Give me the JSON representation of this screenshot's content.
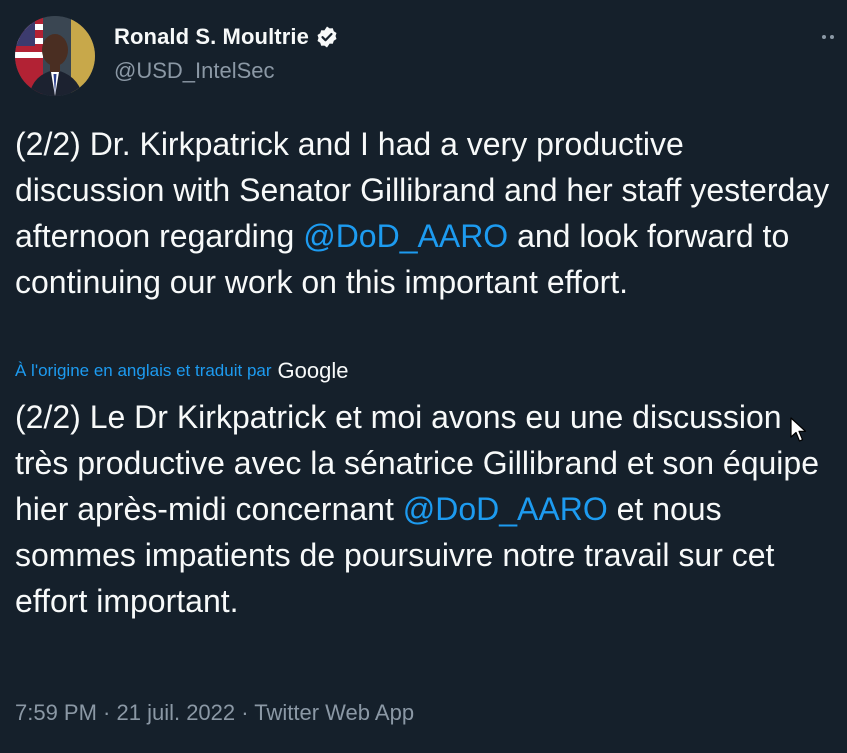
{
  "author": {
    "display_name": "Ronald S. Moultrie",
    "handle": "@USD_IntelSec",
    "verified_icon": "verified-badge-icon"
  },
  "tweet": {
    "original": {
      "before_mention": "(2/2) Dr. Kirkpatrick and I had a very productive discussion with Senator Gillibrand and her staff yesterday afternoon regarding ",
      "mention": "@DoD_AARO",
      "after_mention": " and look forward to continuing our work on this important effort."
    },
    "translation_note": {
      "label": "À l'origine en anglais et traduit par",
      "provider": "Google"
    },
    "translated": {
      "before_mention": "(2/2) Le Dr Kirkpatrick et moi avons eu une discussion très productive avec la sénatrice Gillibrand et son équipe hier après-midi concernant ",
      "mention": "@DoD_AARO",
      "after_mention": " et nous sommes impatients de poursuivre notre travail sur cet effort important."
    },
    "meta": "7:59 PM · 21 juil. 2022 · Twitter Web App"
  },
  "colors": {
    "background": "#15202b",
    "text": "#f7f9f9",
    "secondary": "#8b98a5",
    "accent": "#1d9bf0"
  }
}
